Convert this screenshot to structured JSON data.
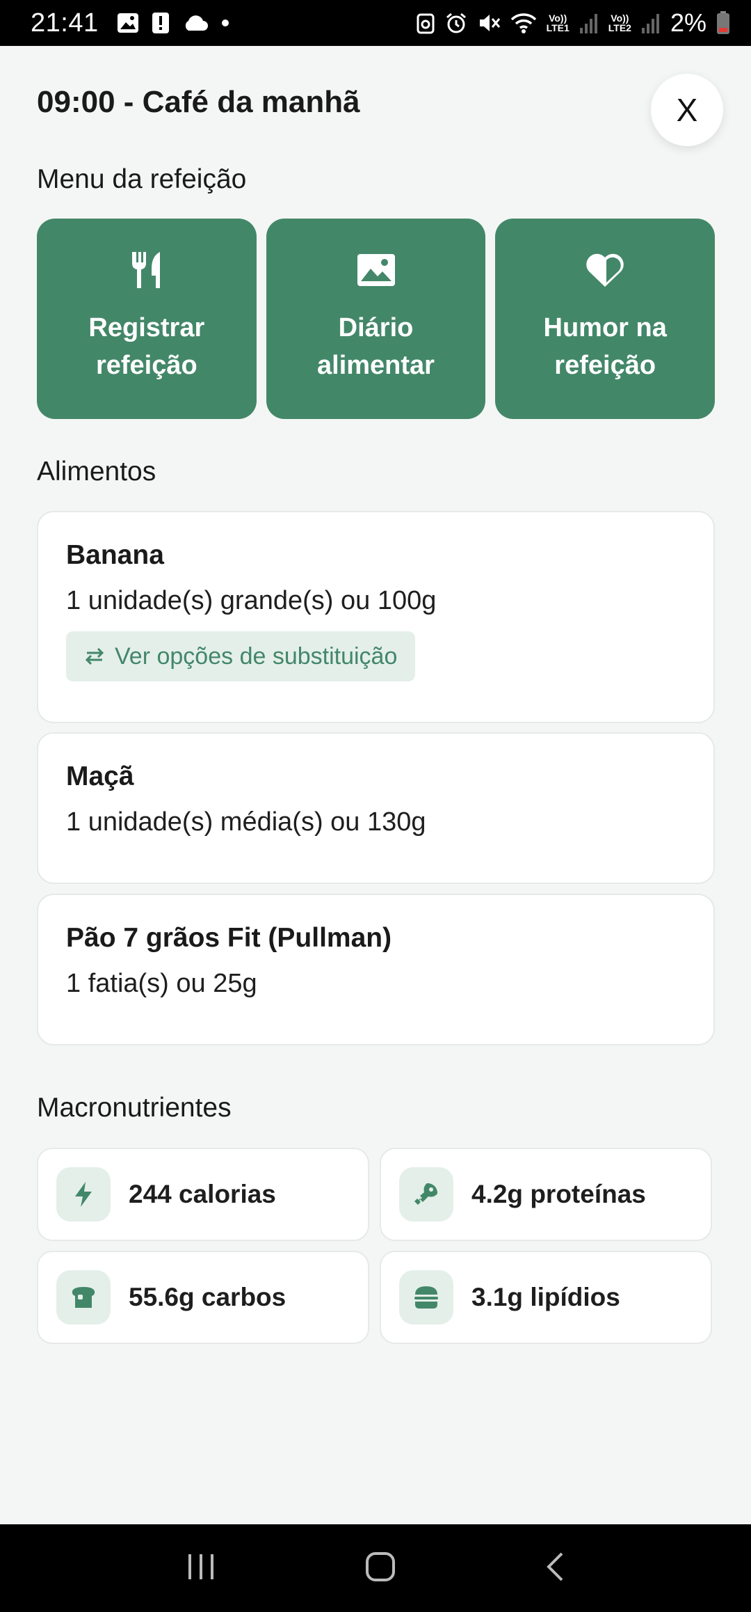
{
  "status_bar": {
    "time": "21:41",
    "net1": "Vo))\nLTE1",
    "net2": "Vo))\nLTE2",
    "battery": "2%"
  },
  "header": {
    "title": "09:00 - Café da manhã",
    "close_label": "X"
  },
  "menu": {
    "section_title": "Menu da refeição",
    "items": [
      {
        "label": "Registrar\nrefeição",
        "icon": "fork-knife-icon"
      },
      {
        "label": "Diário\nalimentar",
        "icon": "image-icon"
      },
      {
        "label": "Humor na\nrefeição",
        "icon": "heart-icon"
      }
    ]
  },
  "foods": {
    "section_title": "Alimentos",
    "items": [
      {
        "name": "Banana",
        "quantity": "1 unidade(s) grande(s) ou 100g",
        "substitution_label": "Ver opções de substituição"
      },
      {
        "name": "Maçã",
        "quantity": "1 unidade(s) média(s) ou 130g"
      },
      {
        "name": "Pão 7 grãos Fit (Pullman)",
        "quantity": "1 fatia(s) ou 25g"
      }
    ]
  },
  "macros": {
    "section_title": "Macronutrientes",
    "items": [
      {
        "label": "244 calorias",
        "icon": "bolt-icon"
      },
      {
        "label": "4.2g proteínas",
        "icon": "drumstick-icon"
      },
      {
        "label": "55.6g carbos",
        "icon": "bread-icon"
      },
      {
        "label": "3.1g lipídios",
        "icon": "burger-icon"
      }
    ]
  },
  "colors": {
    "accent": "#438769",
    "accent_light": "#e4efea",
    "background": "#f4f6f5"
  }
}
